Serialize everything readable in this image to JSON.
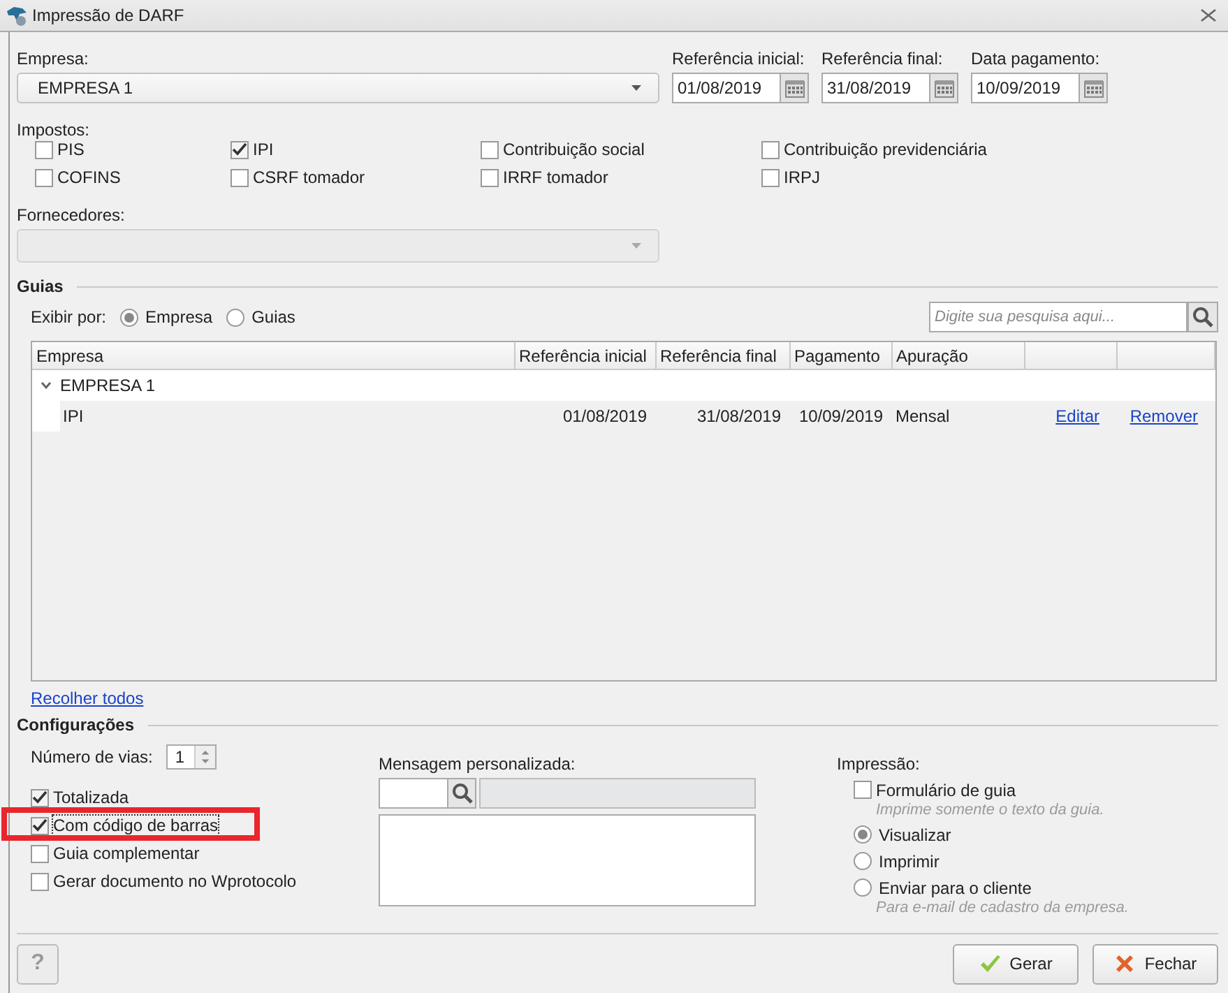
{
  "window": {
    "title": "Impressão de DARF"
  },
  "empresa": {
    "label": "Empresa:",
    "value": "EMPRESA 1"
  },
  "dates": [
    {
      "label": "Referência inicial:",
      "value": "01/08/2019"
    },
    {
      "label": "Referência final:",
      "value": "31/08/2019"
    },
    {
      "label": "Data pagamento:",
      "value": "10/09/2019"
    }
  ],
  "impostos": {
    "label": "Impostos:",
    "items": [
      {
        "label": "PIS",
        "checked": false
      },
      {
        "label": "IPI",
        "checked": true
      },
      {
        "label": "Contribuição social",
        "checked": false
      },
      {
        "label": "Contribuição previdenciária",
        "checked": false
      },
      {
        "label": "COFINS",
        "checked": false
      },
      {
        "label": "CSRF tomador",
        "checked": false
      },
      {
        "label": "IRRF tomador",
        "checked": false
      },
      {
        "label": "IRPJ",
        "checked": false
      }
    ]
  },
  "fornecedores": {
    "label": "Fornecedores:",
    "disabled": true
  },
  "guias": {
    "title": "Guias",
    "exibir_label": "Exibir por:",
    "options": [
      {
        "label": "Empresa",
        "selected": true
      },
      {
        "label": "Guias",
        "selected": false
      }
    ],
    "search": {
      "placeholder": "Digite sua pesquisa aqui..."
    },
    "columns": [
      "Empresa",
      "Referência inicial",
      "Referência final",
      "Pagamento",
      "Apuração"
    ],
    "groups": [
      {
        "name": "EMPRESA 1",
        "expanded": true,
        "rows": [
          {
            "cells": [
              "IPI",
              "01/08/2019",
              "31/08/2019",
              "10/09/2019",
              "Mensal"
            ],
            "actions": [
              "Editar",
              "Remover"
            ]
          }
        ]
      }
    ],
    "collapse_link": "Recolher todos"
  },
  "config": {
    "title": "Configurações",
    "vias_label": "Número de vias:",
    "vias_value": "1",
    "checkboxes": [
      {
        "label": "Totalizada",
        "checked": true,
        "highlighted": false
      },
      {
        "label": "Com código de barras",
        "checked": true,
        "highlighted": true
      },
      {
        "label": "Guia complementar",
        "checked": false,
        "highlighted": false
      },
      {
        "label": "Gerar documento no Wprotocolo",
        "checked": false,
        "highlighted": false
      }
    ],
    "mensagem_label": "Mensagem personalizada:",
    "impressao_label": "Impressão:",
    "impressao": [
      {
        "kind": "checkbox",
        "label": "Formulário de guia",
        "checked": false,
        "hint": "Imprime somente o texto da guia."
      },
      {
        "kind": "radio",
        "label": "Visualizar",
        "selected": true
      },
      {
        "kind": "radio",
        "label": "Imprimir",
        "selected": false
      },
      {
        "kind": "radio",
        "label": "Enviar para o cliente",
        "selected": false,
        "hint": "Para e-mail de cadastro da empresa."
      }
    ]
  },
  "help": "?",
  "buttons": [
    {
      "kind": "ok",
      "label": "Gerar"
    },
    {
      "kind": "cancel",
      "label": "Fechar"
    }
  ]
}
